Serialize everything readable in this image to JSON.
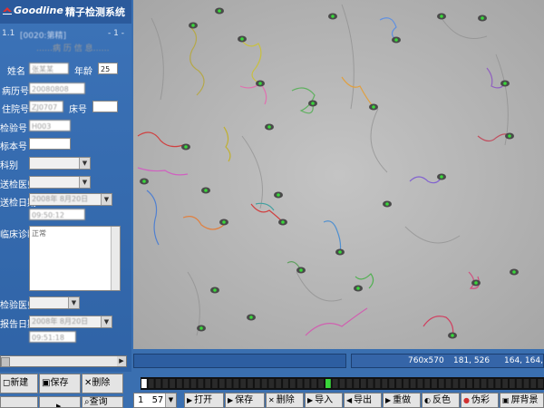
{
  "app": {
    "brand": "Goodline",
    "title": "精子检测系统",
    "case_index": "1.1",
    "case_id": "[0020:第精]",
    "case_counter": "- 1 -",
    "section_label": "……病 历 信 息……"
  },
  "form": {
    "name_label": "姓名",
    "name_value": "张某某",
    "age_label": "年龄",
    "age_value": "25",
    "record_label": "病历号",
    "record_value": "20080808",
    "inpatient_label": "住院号",
    "inpatient_value": "ZJ0707",
    "bed_label": "床号",
    "bed_value": "",
    "sample_label": "检验号",
    "sample_value": "H003",
    "specimen_label": "标本号",
    "specimen_value": "",
    "dept_label": "科别",
    "dept_value": "",
    "doctor_label": "送检医师",
    "doctor_value": "",
    "date_label": "送检日期",
    "date_value": "2008年 8月20日",
    "time_value": "09:50:12",
    "diagnosis_label": "临床诊断",
    "diagnosis_value": "正常",
    "exam_doctor_label": "检验医师",
    "exam_doctor_value": "",
    "report_date_label": "报告日期",
    "report_date_value": "2008年 8月20日",
    "report_time_value": "09:51:18"
  },
  "left_buttons": {
    "new_label": "新建",
    "save_label": "保存",
    "delete_label": "删除",
    "row2_a": "",
    "row2_b": "",
    "row2_c": "查询"
  },
  "status": {
    "resolution": "760x570",
    "cursor": "181, 526",
    "pixel": "164, 164, 1"
  },
  "toolbar": {
    "frame_value": "1",
    "frame_total": "57",
    "open_label": "打开",
    "save_label": "保存",
    "delete_label": "删除",
    "import_label": "导入",
    "export_label": "导出",
    "redo_label": "重做",
    "invert_label": "反色",
    "color_label": "伪彩",
    "background_label": "屏背景"
  },
  "icons": {
    "logo": "goodline-logo-icon",
    "dropdown": "chevron-down-icon",
    "scroll_right": "arrow-right-icon"
  },
  "colors": {
    "panel_blue": "#3a6fb0",
    "image_gray": "#b7b7b7",
    "cell_green": "#38d83a"
  }
}
